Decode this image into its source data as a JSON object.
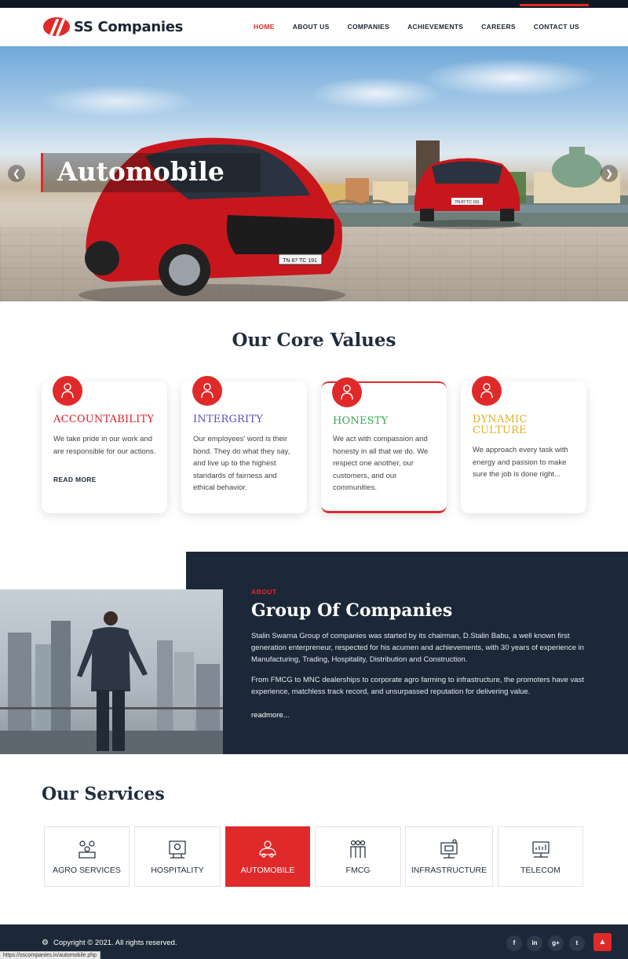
{
  "brand": {
    "name": "SS Companies",
    "color": "#e02a2a",
    "dark": "#1c2837"
  },
  "nav": {
    "items": [
      {
        "label": "HOME",
        "active": true
      },
      {
        "label": "ABOUT US"
      },
      {
        "label": "COMPANIES"
      },
      {
        "label": "ACHIEVEMENTS"
      },
      {
        "label": "CAREERS"
      },
      {
        "label": "CONTACT US"
      }
    ]
  },
  "hero": {
    "caption": "Automobile",
    "prev_icon": "chevron-left-icon",
    "next_icon": "chevron-right-icon",
    "plate_front": "TN 87 TC 191",
    "plate_rear": "TN 87 TC 191"
  },
  "core": {
    "title": "Our Core Values",
    "cards": [
      {
        "title": "ACCOUNTABILITY",
        "color": "#d92027",
        "text": "We take pride in our work and are responsible for our actions.",
        "link": "READ MORE"
      },
      {
        "title": "INTERGRITY",
        "color": "#5a4fb8",
        "text": "Our employees' word is their bond. They do what they say, and live up to the highest standards of fairness and ethical behavior."
      },
      {
        "title": "HONESTY",
        "color": "#3aa653",
        "text": "We act with compassion and honesty in all that we do. We respect one another, our customers, and our communities."
      },
      {
        "title": "DYNAMIC CULTURE",
        "color": "#e0b020",
        "text": "We approach every task with energy and passion to make sure the job is done right..."
      }
    ]
  },
  "about": {
    "label": "ABOUT",
    "title": "Group Of Companies",
    "p1": "Stalin Swarna Group of companies was started by its chairman, D.Stalin Babu, a well known first generation enterpreneur, respected for his acumen and achievements, with 30 years of experience in Manufacturing, Trading, Hospitality, Distribution and Construction.",
    "p2": "From FMCG to MNC dealerships to corporate agro farming to infrastructure, the promoters have vast experience, matchless track record, and unsurpassed reputation for delivering value.",
    "more": "readmore..."
  },
  "services": {
    "title": "Our Services",
    "items": [
      {
        "label": "AGRO SERVICES",
        "icon": "agro-icon"
      },
      {
        "label": "HOSPITALITY",
        "icon": "hospitality-icon"
      },
      {
        "label": "AUTOMOBILE",
        "icon": "automobile-icon",
        "active": true
      },
      {
        "label": "FMCG",
        "icon": "fmcg-icon"
      },
      {
        "label": "INFRASTRUCTURE",
        "icon": "infrastructure-icon"
      },
      {
        "label": "TELECOM",
        "icon": "telecom-icon"
      }
    ]
  },
  "footer": {
    "copyright": "Copyright © 2021. All rights reserved.",
    "social": [
      "f",
      "in",
      "g+",
      "t"
    ]
  },
  "status_url": "https://sscompanies.in/automobile.php"
}
